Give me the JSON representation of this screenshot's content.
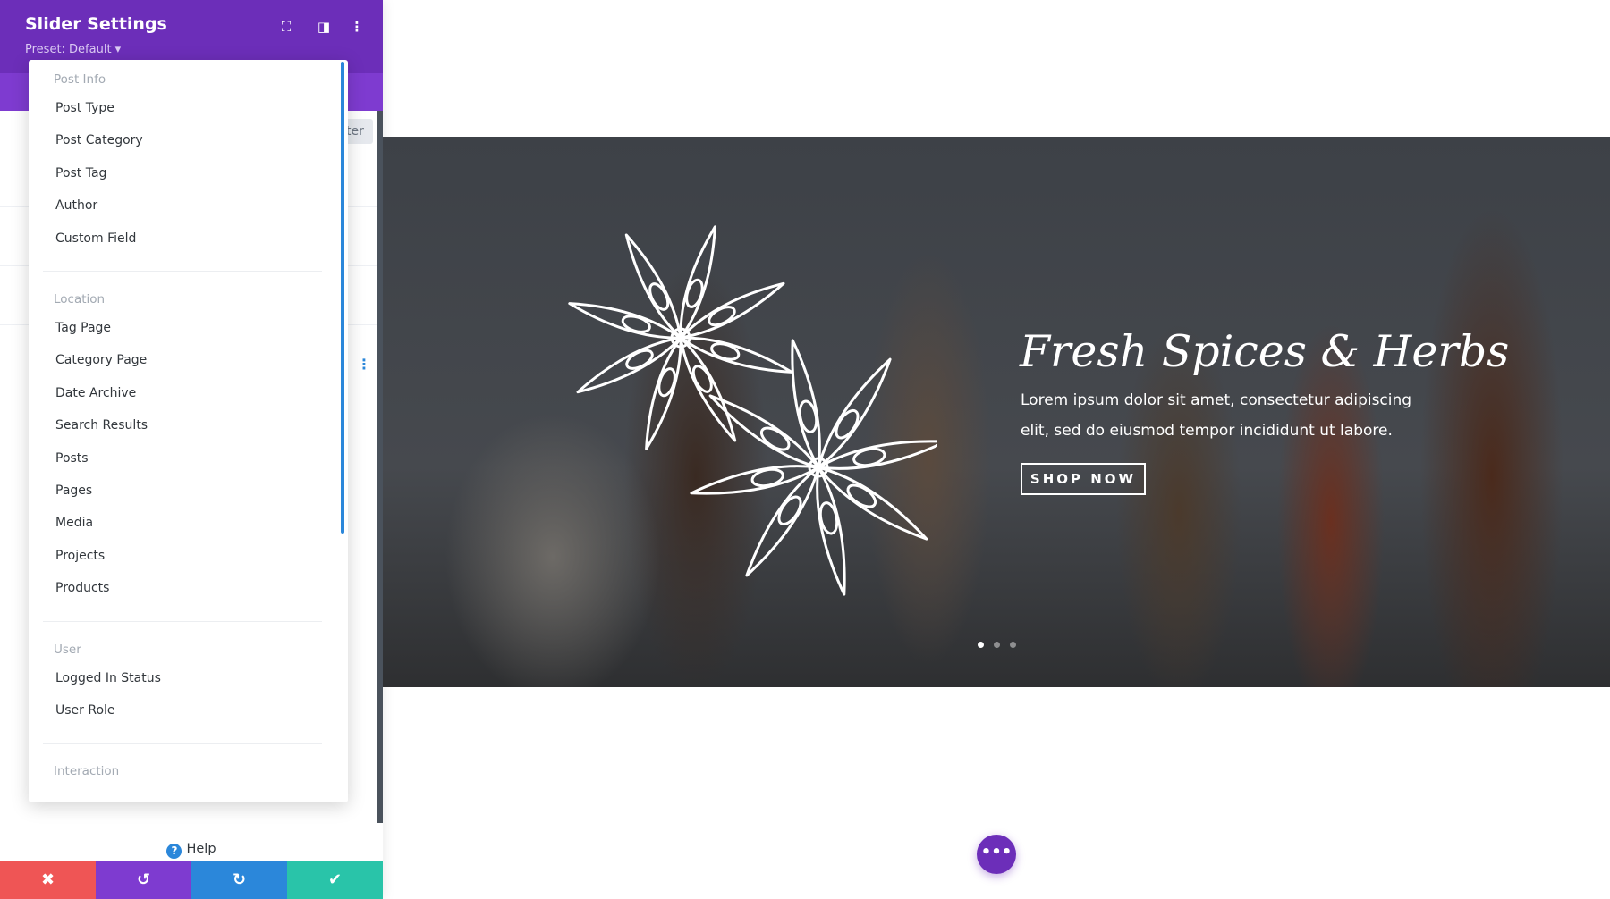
{
  "panel": {
    "title": "Slider Settings",
    "preset": "Preset: Default ▾",
    "partial_button": "ter",
    "help": "Help",
    "icons": [
      "fullscreen-icon",
      "sidebar-layout-icon",
      "more-vertical-icon"
    ]
  },
  "dropdown": {
    "groups": [
      {
        "label": "Post Info",
        "items": [
          "Post Type",
          "Post Category",
          "Post Tag",
          "Author",
          "Custom Field"
        ]
      },
      {
        "label": "Location",
        "items": [
          "Tag Page",
          "Category Page",
          "Date Archive",
          "Search Results",
          "Posts",
          "Pages",
          "Media",
          "Projects",
          "Products"
        ]
      },
      {
        "label": "User",
        "items": [
          "Logged In Status",
          "User Role"
        ]
      },
      {
        "label": "Interaction",
        "items": []
      }
    ]
  },
  "bottom_bar": {
    "colors": {
      "cancel": "#ef5555",
      "undo": "#7e3bd0",
      "redo": "#2b87da",
      "save": "#29c4a9"
    }
  },
  "hero": {
    "title": "Fresh Spices & Herbs",
    "text": "Lorem ipsum dolor sit amet, consectetur adipiscing elit, sed do eiusmod tempor incididunt ut labore.",
    "button": "SHOP NOW",
    "slides": 3,
    "active_slide": 1
  },
  "colors": {
    "accent": "#6c2eb9",
    "blue": "#2b87da"
  }
}
